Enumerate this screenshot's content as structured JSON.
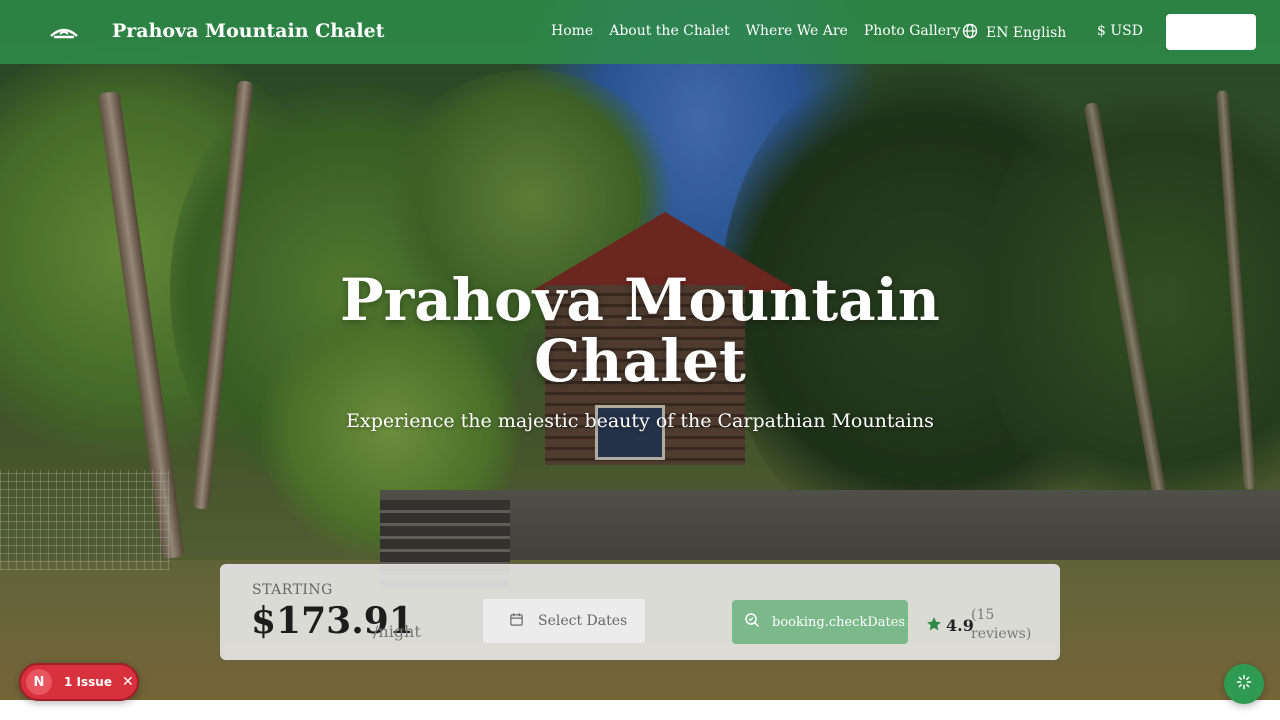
{
  "header": {
    "brand": "Prahova Mountain Chalet",
    "nav": [
      "Home",
      "About the Chalet",
      "Where We Are",
      "Photo Gallery"
    ],
    "language": "EN English",
    "currency": "$ USD",
    "action_button_label": "",
    "logo_icon": "chalet-logo-icon",
    "language_icon": "globe-icon"
  },
  "hero": {
    "title": "Prahova Mountain Chalet",
    "subtitle": "Experience the majestic beauty of the Carpathian Mountains"
  },
  "booking": {
    "starting_label": "STARTING",
    "price": "$173.91",
    "per_night": "/night",
    "select_dates": "Select Dates",
    "check_button": "booking.checkDates",
    "rating": "4.9",
    "reviews": "(15 reviews)",
    "accent_color": "#2e8b48"
  },
  "widgets": {
    "issue_logo": "N",
    "issue_label": "1 Issue"
  }
}
